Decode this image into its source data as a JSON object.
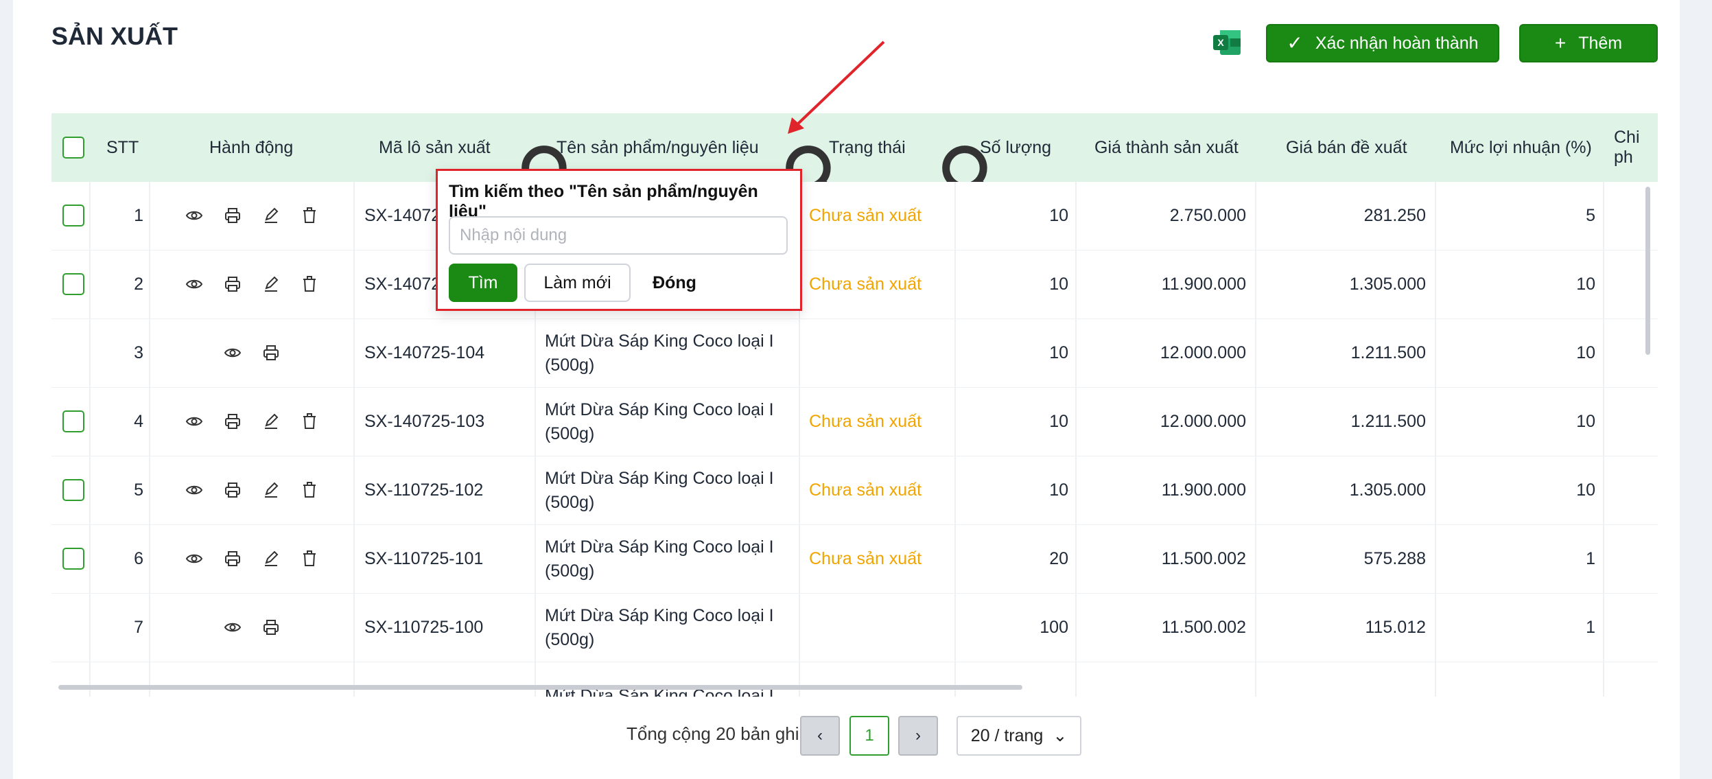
{
  "page": {
    "title": "SẢN XUẤT"
  },
  "toolbar": {
    "confirm_label": "Xác nhận hoàn thành",
    "add_label": "Thêm",
    "excel_icon": "excel-icon",
    "accent_color": "#1a8a14"
  },
  "table": {
    "headers": {
      "stt": "STT",
      "actions": "Hành động",
      "batch": "Mã lô sản xuất",
      "product": "Tên sản phẩm/nguyên liệu",
      "status": "Trạng thái",
      "qty": "Số lượng",
      "cost": "Giá thành sản xuất",
      "price": "Giá bán đề xuất",
      "margin": "Mức lợi nhuận (%)",
      "extra": "Chi ph"
    },
    "rows": [
      {
        "stt": "1",
        "batch": "SX-14072",
        "product": "",
        "status": "Chưa sản xuất",
        "qty": "10",
        "cost": "2.750.000",
        "price": "281.250",
        "margin": "5",
        "checkbox": true,
        "edit": true
      },
      {
        "stt": "2",
        "batch": "SX-14072",
        "product": "",
        "status": "Chưa sản xuất",
        "qty": "10",
        "cost": "11.900.000",
        "price": "1.305.000",
        "margin": "10",
        "checkbox": true,
        "edit": true
      },
      {
        "stt": "3",
        "batch": "SX-140725-104",
        "product": "Mứt Dừa Sáp King Coco loại I (500g)",
        "status": "",
        "qty": "10",
        "cost": "12.000.000",
        "price": "1.211.500",
        "margin": "10",
        "checkbox": false,
        "edit": false
      },
      {
        "stt": "4",
        "batch": "SX-140725-103",
        "product": "Mứt Dừa Sáp King Coco loại I (500g)",
        "status": "Chưa sản xuất",
        "qty": "10",
        "cost": "12.000.000",
        "price": "1.211.500",
        "margin": "10",
        "checkbox": true,
        "edit": true
      },
      {
        "stt": "5",
        "batch": "SX-110725-102",
        "product": "Mứt Dừa Sáp King Coco loại I (500g)",
        "status": "Chưa sản xuất",
        "qty": "10",
        "cost": "11.900.000",
        "price": "1.305.000",
        "margin": "10",
        "checkbox": true,
        "edit": true
      },
      {
        "stt": "6",
        "batch": "SX-110725-101",
        "product": "Mứt Dừa Sáp King Coco loại I (500g)",
        "status": "Chưa sản xuất",
        "qty": "20",
        "cost": "11.500.002",
        "price": "575.288",
        "margin": "1",
        "checkbox": true,
        "edit": true
      },
      {
        "stt": "7",
        "batch": "SX-110725-100",
        "product": "Mứt Dừa Sáp King Coco loại I (500g)",
        "status": "",
        "qty": "100",
        "cost": "11.500.002",
        "price": "115.012",
        "margin": "1",
        "checkbox": false,
        "edit": false
      },
      {
        "stt": "",
        "batch": "",
        "product": "Mứt Dừa Sáp King Coco loại I",
        "status": "",
        "qty": "",
        "cost": "",
        "price": "",
        "margin": "",
        "checkbox": false,
        "edit": false
      }
    ],
    "status_color": "#f0a500",
    "header_bg": "#dff3e6"
  },
  "search_popup": {
    "title": "Tìm kiếm theo \"Tên sản phẩm/nguyên liệu\"",
    "placeholder": "Nhập nội dung",
    "value": "",
    "search_label": "Tìm",
    "reset_label": "Làm mới",
    "close_label": "Đóng"
  },
  "pagination": {
    "total_text": "Tổng cộng 20 bản ghi",
    "current_page": "1",
    "page_size": "20 / trang"
  }
}
